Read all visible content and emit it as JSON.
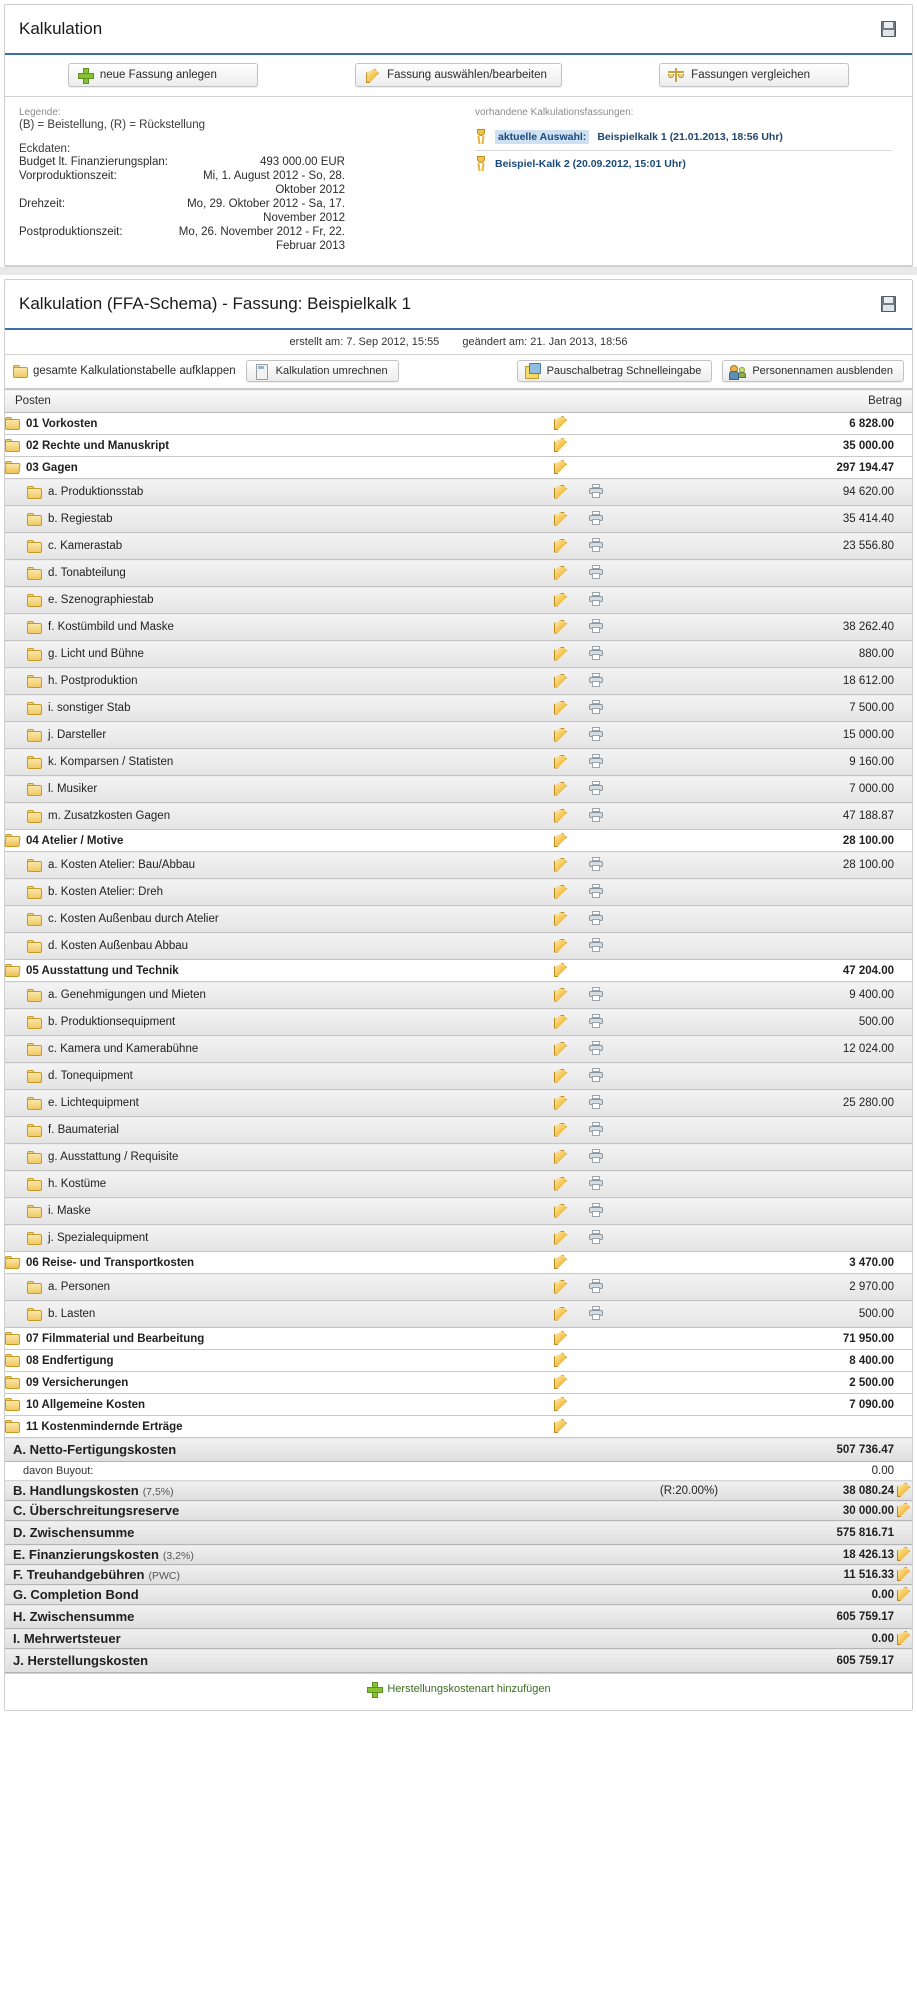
{
  "top_panel": {
    "title": "Kalkulation",
    "save_icon": "save-disk-icon",
    "buttons": [
      {
        "label": "neue Fassung anlegen",
        "icon": "plus-icon"
      },
      {
        "label": "Fassung auswählen/bearbeiten",
        "icon": "pencil-icon"
      },
      {
        "label": "Fassungen vergleichen",
        "icon": "scales-icon"
      }
    ],
    "legend": {
      "title": "Legende:",
      "line": "(B) = Beistellung, (R) = Rückstellung"
    },
    "eckdaten": {
      "title": "Eckdaten:",
      "rows": [
        {
          "key": "Budget lt. Finanzierungsplan:",
          "value": "493 000.00 EUR"
        },
        {
          "key": "Vorproduktionszeit:",
          "value": "Mi, 1. August 2012 - So, 28. Oktober 2012"
        },
        {
          "key": "Drehzeit:",
          "value": "Mo, 29. Oktober 2012 - Sa, 17. November 2012"
        },
        {
          "key": "Postproduktionszeit:",
          "value": "Mo, 26. November 2012 - Fr, 22. Februar 2013"
        }
      ]
    },
    "versions": {
      "title": "vorhandene Kalkulationsfassungen:",
      "items": [
        {
          "badge": "aktuelle Auswahl:",
          "label": "Beispielkalk 1 (21.01.2013, 18:56 Uhr)",
          "selected": true
        },
        {
          "badge": "",
          "label": "Beispiel-Kalk 2 (20.09.2012, 15:01 Uhr)",
          "selected": false
        }
      ]
    }
  },
  "main_panel": {
    "title": "Kalkulation (FFA-Schema) - Fassung: Beispielkalk 1",
    "save_icon": "save-disk-icon",
    "meta": {
      "created": "erstellt am: 7. Sep 2012, 15:55",
      "modified": "geändert am: 21. Jan 2013, 18:56"
    },
    "toolbar": {
      "expand_all": "gesamte Kalkulationstabelle aufklappen",
      "recalc": "Kalkulation umrechnen",
      "lumpsum": "Pauschalbetrag Schnelleingabe",
      "hide_names": "Personennamen ausblenden"
    },
    "table": {
      "headers": {
        "posten": "Posten",
        "betrag": "Betrag"
      },
      "rows": [
        {
          "level": 1,
          "name": "01 Vorkosten",
          "amount": "6 828.00",
          "edit": true,
          "print": false
        },
        {
          "level": 1,
          "name": "02 Rechte und Manuskript",
          "amount": "35 000.00",
          "edit": true,
          "print": false
        },
        {
          "level": 1,
          "name": "03 Gagen",
          "amount": "297 194.47",
          "edit": true,
          "print": false,
          "open": true
        },
        {
          "level": 2,
          "name": "a. Produktionsstab",
          "amount": "94 620.00",
          "edit": true,
          "print": true
        },
        {
          "level": 2,
          "name": "b. Regiestab",
          "amount": "35 414.40",
          "edit": true,
          "print": true
        },
        {
          "level": 2,
          "name": "c. Kamerastab",
          "amount": "23 556.80",
          "edit": true,
          "print": true
        },
        {
          "level": 2,
          "name": "d. Tonabteilung",
          "amount": "",
          "edit": true,
          "print": true
        },
        {
          "level": 2,
          "name": "e. Szenographiestab",
          "amount": "",
          "edit": true,
          "print": true
        },
        {
          "level": 2,
          "name": "f. Kostümbild und Maske",
          "amount": "38 262.40",
          "edit": true,
          "print": true
        },
        {
          "level": 2,
          "name": "g. Licht und Bühne",
          "amount": "880.00",
          "edit": true,
          "print": true
        },
        {
          "level": 2,
          "name": "h. Postproduktion",
          "amount": "18 612.00",
          "edit": true,
          "print": true
        },
        {
          "level": 2,
          "name": "i. sonstiger Stab",
          "amount": "7 500.00",
          "edit": true,
          "print": true
        },
        {
          "level": 2,
          "name": "j. Darsteller",
          "amount": "15 000.00",
          "edit": true,
          "print": true
        },
        {
          "level": 2,
          "name": "k. Komparsen / Statisten",
          "amount": "9 160.00",
          "edit": true,
          "print": true
        },
        {
          "level": 2,
          "name": "l. Musiker",
          "amount": "7 000.00",
          "edit": true,
          "print": true
        },
        {
          "level": 2,
          "name": "m. Zusatzkosten Gagen",
          "amount": "47 188.87",
          "edit": true,
          "print": true
        },
        {
          "level": 1,
          "name": "04 Atelier / Motive",
          "amount": "28 100.00",
          "edit": true,
          "print": false,
          "open": true
        },
        {
          "level": 2,
          "name": "a. Kosten Atelier: Bau/Abbau",
          "amount": "28 100.00",
          "edit": true,
          "print": true
        },
        {
          "level": 2,
          "name": "b. Kosten Atelier: Dreh",
          "amount": "",
          "edit": true,
          "print": true
        },
        {
          "level": 2,
          "name": "c. Kosten Außenbau durch Atelier",
          "amount": "",
          "edit": true,
          "print": true
        },
        {
          "level": 2,
          "name": "d. Kosten Außenbau Abbau",
          "amount": "",
          "edit": true,
          "print": true
        },
        {
          "level": 1,
          "name": "05 Ausstattung und Technik",
          "amount": "47 204.00",
          "edit": true,
          "print": false,
          "open": true
        },
        {
          "level": 2,
          "name": "a. Genehmigungen und Mieten",
          "amount": "9 400.00",
          "edit": true,
          "print": true
        },
        {
          "level": 2,
          "name": "b. Produktionsequipment",
          "amount": "500.00",
          "edit": true,
          "print": true
        },
        {
          "level": 2,
          "name": "c. Kamera und Kamerabühne",
          "amount": "12 024.00",
          "edit": true,
          "print": true
        },
        {
          "level": 2,
          "name": "d. Tonequipment",
          "amount": "",
          "edit": true,
          "print": true
        },
        {
          "level": 2,
          "name": "e. Lichtequipment",
          "amount": "25 280.00",
          "edit": true,
          "print": true
        },
        {
          "level": 2,
          "name": "f. Baumaterial",
          "amount": "",
          "edit": true,
          "print": true
        },
        {
          "level": 2,
          "name": "g. Ausstattung / Requisite",
          "amount": "",
          "edit": true,
          "print": true
        },
        {
          "level": 2,
          "name": "h. Kostüme",
          "amount": "",
          "edit": true,
          "print": true
        },
        {
          "level": 2,
          "name": "i. Maske",
          "amount": "",
          "edit": true,
          "print": true
        },
        {
          "level": 2,
          "name": "j. Spezialequipment",
          "amount": "",
          "edit": true,
          "print": true
        },
        {
          "level": 1,
          "name": "06 Reise- und Transportkosten",
          "amount": "3 470.00",
          "edit": true,
          "print": false,
          "open": true
        },
        {
          "level": 2,
          "name": "a. Personen",
          "amount": "2 970.00",
          "edit": true,
          "print": true
        },
        {
          "level": 2,
          "name": "b. Lasten",
          "amount": "500.00",
          "edit": true,
          "print": true
        },
        {
          "level": 1,
          "name": "07 Filmmaterial und Bearbeitung",
          "amount": "71 950.00",
          "edit": true,
          "print": false
        },
        {
          "level": 1,
          "name": "08 Endfertigung",
          "amount": "8 400.00",
          "edit": true,
          "print": false
        },
        {
          "level": 1,
          "name": "09 Versicherungen",
          "amount": "2 500.00",
          "edit": true,
          "print": false
        },
        {
          "level": 1,
          "name": "10 Allgemeine Kosten",
          "amount": "7 090.00",
          "edit": true,
          "print": false
        },
        {
          "level": 1,
          "name": "11 Kostenmindernde Erträge",
          "amount": "",
          "edit": true,
          "print": false
        }
      ],
      "summary": [
        {
          "kind": "total",
          "name": "A. Netto-Fertigungskosten",
          "pct": "",
          "mid": "",
          "amount": "507 736.47",
          "edit": false
        },
        {
          "kind": "sub",
          "name": "davon Buyout:",
          "pct": "",
          "mid": "",
          "amount": "0.00",
          "edit": false
        },
        {
          "kind": "row",
          "name": "B. Handlungskosten",
          "pct": "(7,5%)",
          "mid": "(R:20.00%)",
          "amount": "38 080.24",
          "edit": true
        },
        {
          "kind": "row",
          "name": "C. Überschreitungsreserve",
          "pct": "",
          "mid": "",
          "amount": "30 000.00",
          "edit": true
        },
        {
          "kind": "total",
          "name": "D. Zwischensumme",
          "pct": "",
          "mid": "",
          "amount": "575 816.71",
          "edit": false
        },
        {
          "kind": "row",
          "name": "E. Finanzierungskosten",
          "pct": "(3,2%)",
          "mid": "",
          "amount": "18 426.13",
          "edit": true
        },
        {
          "kind": "row",
          "name": "F. Treuhandgebühren",
          "pct": "(PWC)",
          "mid": "",
          "amount": "11 516.33",
          "edit": true
        },
        {
          "kind": "row",
          "name": "G. Completion Bond",
          "pct": "",
          "mid": "",
          "amount": "0.00",
          "edit": true
        },
        {
          "kind": "total",
          "name": "H. Zwischensumme",
          "pct": "",
          "mid": "",
          "amount": "605 759.17",
          "edit": false
        },
        {
          "kind": "row",
          "name": "I. Mehrwertsteuer",
          "pct": "",
          "mid": "",
          "amount": "0.00",
          "edit": true
        },
        {
          "kind": "total",
          "name": "J. Herstellungskosten",
          "pct": "",
          "mid": "",
          "amount": "605 759.17",
          "edit": false
        }
      ],
      "add_link": "Herstellungskostenart hinzufügen"
    }
  }
}
